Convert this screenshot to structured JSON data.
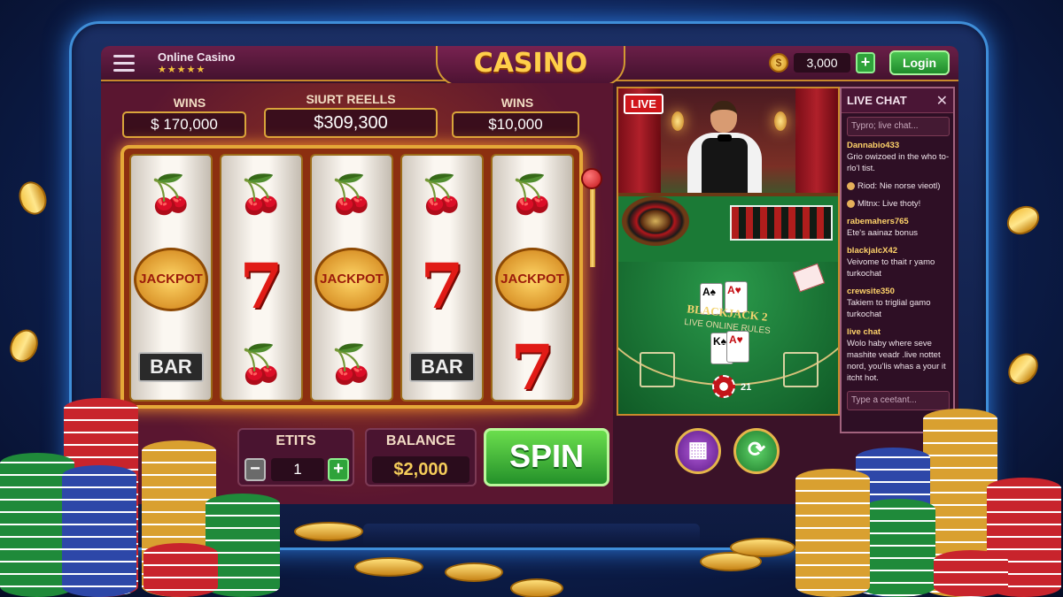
{
  "header": {
    "brand": "Online Casino",
    "rating": "★★★★★",
    "title": "CASINO",
    "coin_balance": "3,000",
    "add_label": "+",
    "login_label": "Login"
  },
  "stats": [
    {
      "label": "WINS",
      "value": "$ 170,000"
    },
    {
      "label": "SIURT REELLS",
      "value": "$309,300"
    },
    {
      "label": "WINS",
      "value": "$10,000"
    }
  ],
  "reels": [
    [
      "cherry",
      "JACKPOT",
      "BAR"
    ],
    [
      "cherry",
      "7",
      "cherry"
    ],
    [
      "cherry",
      "JACKPOT",
      "cherry"
    ],
    [
      "cherry",
      "7",
      "BAR"
    ],
    [
      "cherry",
      "JACKPOT",
      "7"
    ]
  ],
  "symbols": {
    "cherry": "🍒",
    "bar": "BAR",
    "jackpot": "JACKPOT",
    "seven": "7"
  },
  "controls": {
    "bets_label": "ETITS",
    "bet_value": "1",
    "minus": "−",
    "plus": "+",
    "balance_label": "BALANCE",
    "balance_value": "$2,000",
    "spin_label": "SPIN"
  },
  "live": {
    "badge": "LIVE",
    "blackjack_title": "BLACKJACK",
    "blackjack_extra": "2",
    "blackjack_sub": "LIVE ONLINE RULES",
    "card1": "A♠",
    "card2": "A♥",
    "card3": "K♠",
    "card4": "A♥",
    "chip_count": "21"
  },
  "chat": {
    "title": "LIVE CHAT",
    "close": "✕",
    "search_placeholder": "Typro; live chat...",
    "messages": [
      {
        "user": "Dannabio433",
        "text": "Grio owizoed in the who to-rlo'l tist."
      },
      {
        "user": "",
        "text": "Riod: Nie norse vieotl)"
      },
      {
        "user": "",
        "text": "Mltnx: Live thoty!"
      },
      {
        "user": "rabemahers765",
        "text": "Ete's aainaz bonus"
      },
      {
        "user": "blackjalcX42",
        "text": "Veivome to thait r yamo turkochat"
      },
      {
        "user": "crewsite350",
        "text": "Takiem to triglial gamo turkochat"
      },
      {
        "user": "live chat",
        "text": "Wolo haby where seve mashite veadr .live nottet nord, you'lis whas a your it itcht hot."
      }
    ],
    "input_placeholder": "Type a ceetant..."
  },
  "actions": {
    "table_icon": "▦",
    "refresh_icon": "⟳"
  },
  "colors": {
    "accent": "#d9a53b",
    "spin": "#3cb83a",
    "chat_user": "#ffd36a"
  }
}
